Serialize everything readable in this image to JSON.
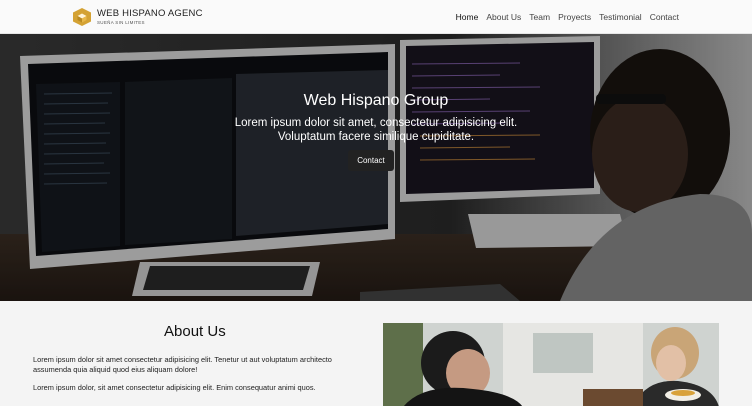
{
  "brand": {
    "name": "WEB HISPANO AGENC",
    "tagline": "SUEÑA SIN LIMITES",
    "logo_icon": "hexagon-logo-icon",
    "logo_color": "#d4a233"
  },
  "nav": {
    "links": [
      "Home",
      "About Us",
      "Team",
      "Proyects",
      "Testimonial",
      "Contact"
    ],
    "active": "Home"
  },
  "hero": {
    "title": "Web Hispano Group",
    "subtitle_line1": "Lorem ipsum dolor sit amet, consectetur adipisicing elit.",
    "subtitle_line2": "Voluptatum facere similique cupiditate.",
    "button_label": "Contact",
    "image": "developer-at-desk-with-monitors-photo"
  },
  "about": {
    "title": "About Us",
    "paragraph1": "Lorem ipsum dolor sit amet consectetur adipisicing elit. Tenetur ut aut voluptatum architecto assumenda quia aliquid quod eius aliquam dolore!",
    "paragraph2": "Lorem ipsum dolor, sit amet consectetur adipisicing elit. Enim consequatur animi quos.",
    "image": "team-meeting-photo"
  }
}
